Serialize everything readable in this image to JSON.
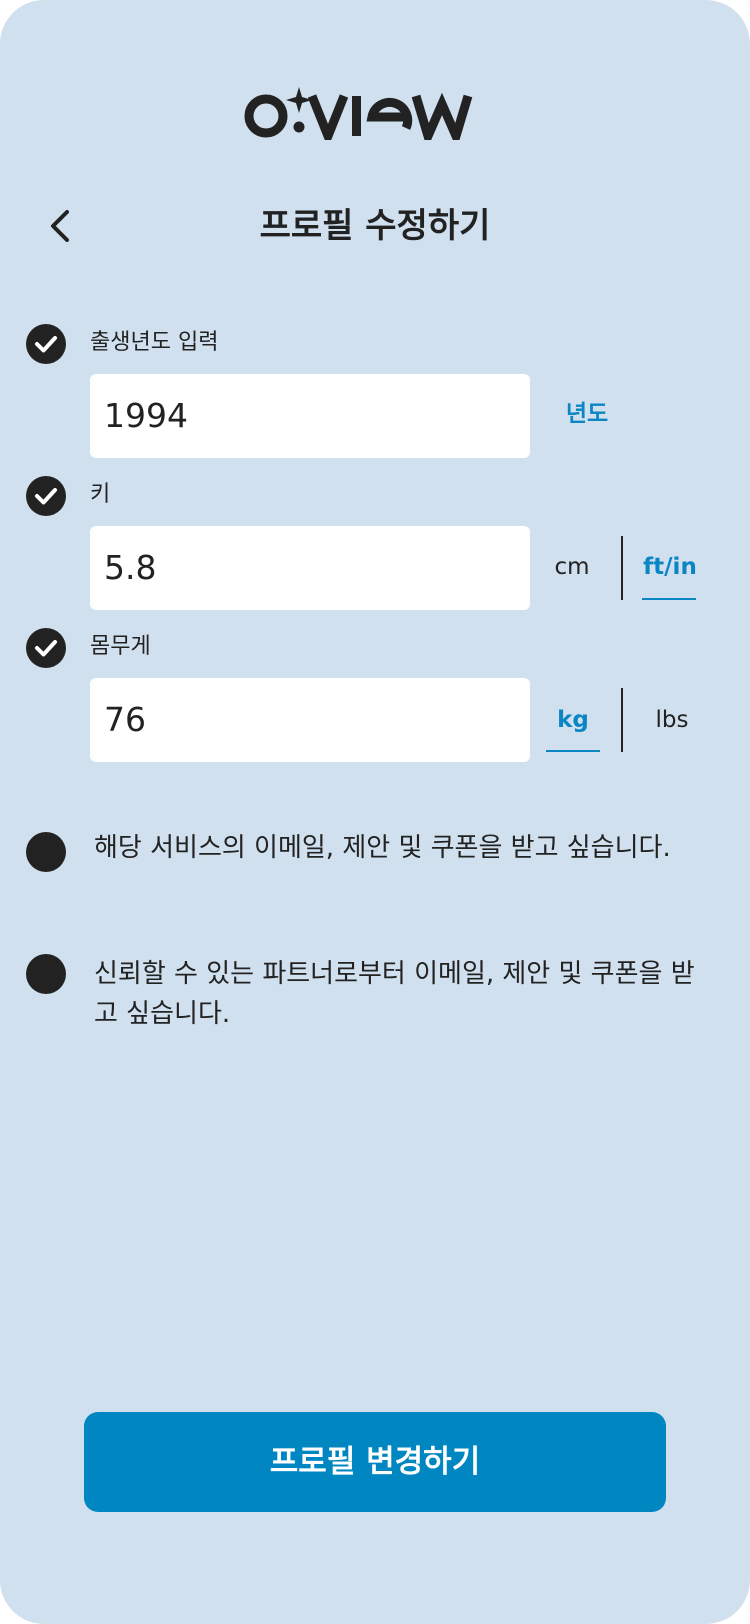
{
  "app": {
    "logo_text": "O:VIEW"
  },
  "header": {
    "title": "프로필 수정하기"
  },
  "form": {
    "birth_year": {
      "label": "출생년도 입력",
      "value": "1994",
      "unit": "년도"
    },
    "height": {
      "label": "키",
      "value": "5.8",
      "units": [
        "cm",
        "ft/in"
      ],
      "selected_unit": "ft/in"
    },
    "weight": {
      "label": "몸무게",
      "value": "76",
      "units": [
        "kg",
        "lbs"
      ],
      "selected_unit": "kg"
    }
  },
  "consents": [
    {
      "text": "해당 서비스의 이메일, 제안 및 쿠폰을 받고 싶습니다.",
      "checked": false
    },
    {
      "text": "신뢰할 수 있는 파트너로부터 이메일, 제안 및 쿠폰을 받고 싶습니다.",
      "checked": false
    }
  ],
  "submit": {
    "label": "프로필 변경하기"
  },
  "colors": {
    "background": "#d0e0ef",
    "accent": "#0086c0",
    "dark": "#222222"
  },
  "icons": [
    "back-chevron-icon",
    "check-icon"
  ]
}
